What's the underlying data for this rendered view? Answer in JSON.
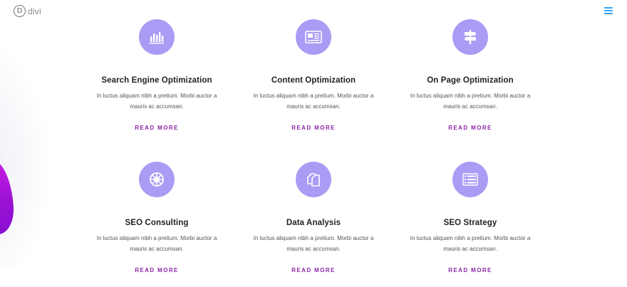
{
  "header": {
    "logo_mark": "D",
    "logo_text": "divi"
  },
  "colors": {
    "icon_bg": "#a99cf5",
    "link": "#8b23a8",
    "menu": "#2ea3f2",
    "accent_shape": "#9b12d6"
  },
  "features": [
    {
      "icon": "bar-chart-icon",
      "title": "Search Engine Optimization",
      "text": "In luctus aliquam nibh a pretium. Morbi auctor a mauris ac accumsan.",
      "link": "READ MORE"
    },
    {
      "icon": "newspaper-icon",
      "title": "Content Optimization",
      "text": "In luctus aliquam nibh a pretium. Morbi auctor a mauris ac accumsan.",
      "link": "READ MORE"
    },
    {
      "icon": "signpost-icon",
      "title": "On Page Optimization",
      "text": "In luctus aliquam nibh a pretium. Morbi auctor a mauris ac accumsan.",
      "link": "READ MORE"
    },
    {
      "icon": "life-ring-icon",
      "title": "SEO Consulting",
      "text": "In luctus aliquam nibh a pretium. Morbi auctor a mauris ac accumsan.",
      "link": "READ MORE"
    },
    {
      "icon": "copy-documents-icon",
      "title": "Data Analysis",
      "text": "In luctus aliquam nibh a pretium. Morbi auctor a mauris ac accumsan.",
      "link": "READ MORE"
    },
    {
      "icon": "list-icon",
      "title": "SEO Strategy",
      "text": "In luctus aliquam nibh a pretium. Morbi auctor a mauris ac accumsan.",
      "link": "READ MORE"
    }
  ]
}
